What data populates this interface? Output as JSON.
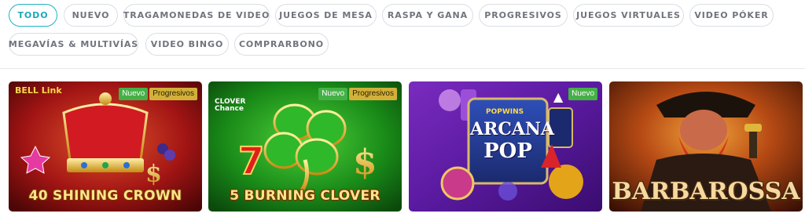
{
  "filters": [
    {
      "label": "TODO",
      "active": true
    },
    {
      "label": "NUEVO",
      "active": false
    },
    {
      "label": "TRAGAMONEDAS DE VIDEO",
      "active": false
    },
    {
      "label": "JUEGOS DE MESA",
      "active": false
    },
    {
      "label": "RASPA Y GANA",
      "active": false
    },
    {
      "label": "PROGRESIVOS",
      "active": false
    },
    {
      "label": "JUEGOS VIRTUALES",
      "active": false
    },
    {
      "label": "VIDEO PÓKER",
      "active": false
    },
    {
      "label": "MEGAVÍAS & MULTIVÍAS",
      "active": false
    },
    {
      "label": "VIDEO BINGO",
      "active": false
    },
    {
      "label": "COMPRARBONO",
      "active": false
    }
  ],
  "games": [
    {
      "title": "40 SHINING CROWN",
      "logo": "BELL Link",
      "badges": [
        "Nuevo",
        "Progresivos"
      ]
    },
    {
      "title": "5 BURNING CLOVER",
      "logo": "CLOVER Chance",
      "badges": [
        "Nuevo",
        "Progresivos"
      ]
    },
    {
      "title": "ARCANA POP",
      "logo": "POPWINS",
      "title_line1": "ARCANA",
      "title_line2": "POP",
      "badges": [
        "Nuevo"
      ]
    },
    {
      "title": "BARBAROSSA",
      "badges": []
    }
  ],
  "colors": {
    "accent": "#1fb3c4",
    "badge_new": "#45b046",
    "badge_progressive": "#d2b03a"
  }
}
